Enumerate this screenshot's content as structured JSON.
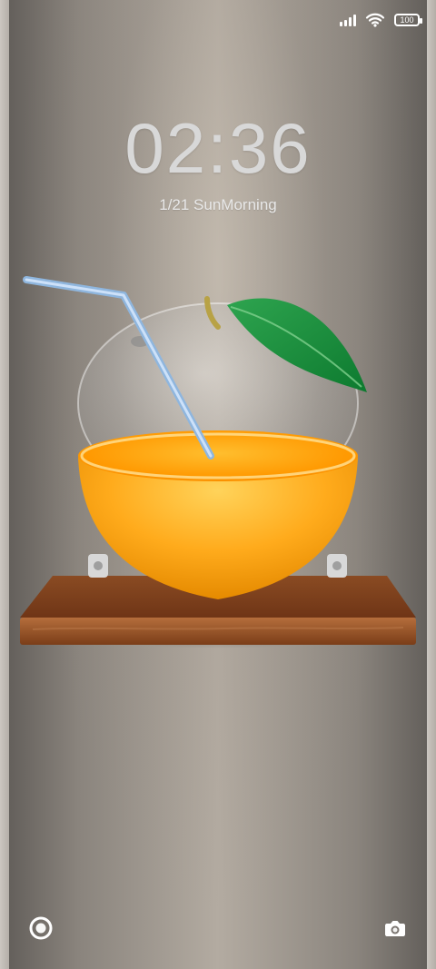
{
  "status_bar": {
    "battery_level": "100"
  },
  "lockscreen": {
    "time": "02:36",
    "date_text": "1/21 SunMorning"
  },
  "shortcuts": {
    "left_icon": "ring-icon",
    "right_icon": "camera-icon"
  },
  "wallpaper": {
    "subject": "orange-glass-with-straw-on-wooden-shelf"
  }
}
